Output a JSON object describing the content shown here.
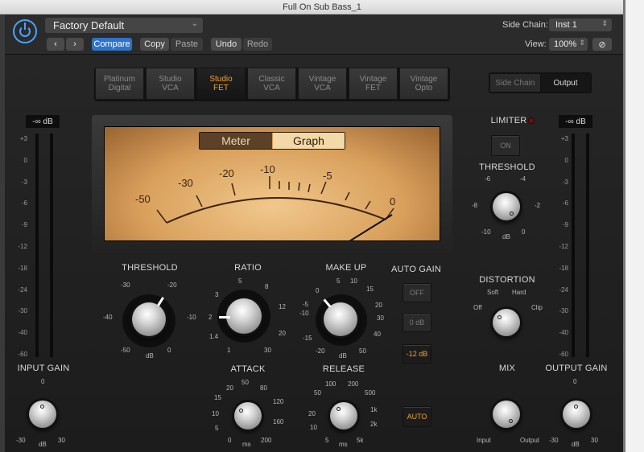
{
  "window": {
    "title": "Full On Sub Bass_1"
  },
  "header": {
    "preset": "Factory Default",
    "compare": "Compare",
    "copy": "Copy",
    "paste": "Paste",
    "undo": "Undo",
    "redo": "Redo",
    "side_chain_label": "Side Chain:",
    "side_chain_value": "Inst 1",
    "view_label": "View:",
    "view_value": "100%"
  },
  "models": [
    {
      "l1": "Platinum",
      "l2": "Digital"
    },
    {
      "l1": "Studio",
      "l2": "VCA"
    },
    {
      "l1": "Studio",
      "l2": "FET"
    },
    {
      "l1": "Classic",
      "l2": "VCA"
    },
    {
      "l1": "Vintage",
      "l2": "VCA"
    },
    {
      "l1": "Vintage",
      "l2": "FET"
    },
    {
      "l1": "Vintage",
      "l2": "Opto"
    }
  ],
  "selected_model": "Studio FET",
  "sidechain_tabs": {
    "side": "Side Chain",
    "output": "Output"
  },
  "meter": {
    "tab_meter": "Meter",
    "tab_graph": "Graph",
    "scale": [
      "-50",
      "-30",
      "-20",
      "-10",
      "-5",
      "0"
    ]
  },
  "input_meter": {
    "value": "-∞ dB",
    "scale": [
      "+3",
      "0",
      "-3",
      "-6",
      "-9",
      "-12",
      "-18",
      "-24",
      "-30",
      "-40",
      "-60"
    ]
  },
  "output_meter": {
    "value": "-∞ dB",
    "scale": [
      "+3",
      "0",
      "-3",
      "-6",
      "-9",
      "-12",
      "-18",
      "-24",
      "-30",
      "-40",
      "-60"
    ]
  },
  "threshold": {
    "label": "THRESHOLD",
    "ticks": [
      "-30",
      "-20",
      "-40",
      "-10",
      "-50",
      "0"
    ],
    "unit": "dB"
  },
  "ratio": {
    "label": "RATIO",
    "ticks": [
      "5",
      "3",
      "8",
      "12",
      "2",
      "1.4",
      "20",
      "1",
      "30"
    ]
  },
  "makeup": {
    "label": "MAKE UP",
    "ticks": [
      "0",
      "5",
      "10",
      "-5",
      "15",
      "-10",
      "20",
      "30",
      "-15",
      "40",
      "-20",
      "50"
    ],
    "unit": "dB"
  },
  "auto_gain": {
    "label": "AUTO GAIN",
    "off": "OFF",
    "zero": "0 dB",
    "minus12": "-12 dB"
  },
  "attack": {
    "label": "ATTACK",
    "ticks": [
      "20",
      "50",
      "80",
      "15",
      "120",
      "10",
      "160",
      "5",
      "200",
      "0"
    ],
    "unit": "ms"
  },
  "release": {
    "label": "RELEASE",
    "ticks": [
      "100",
      "200",
      "50",
      "500",
      "20",
      "1k",
      "10",
      "2k",
      "5",
      "5k"
    ],
    "unit": "ms",
    "auto": "AUTO"
  },
  "limiter": {
    "label": "LIMITER",
    "on": "ON",
    "threshold_label": "THRESHOLD",
    "ticks": [
      "-6",
      "-4",
      "-8",
      "-2",
      "-10",
      "0"
    ],
    "unit": "dB"
  },
  "distortion": {
    "label": "DISTORTION",
    "soft": "Soft",
    "hard": "Hard",
    "off": "Off",
    "clip": "Clip"
  },
  "mix": {
    "label": "MIX",
    "input": "Input",
    "output": "Output"
  },
  "input_gain": {
    "label": "INPUT GAIN",
    "top": "0",
    "left": "-30",
    "right": "30",
    "unit": "dB"
  },
  "output_gain": {
    "label": "OUTPUT GAIN",
    "top": "0",
    "left": "-30",
    "right": "30",
    "unit": "dB"
  }
}
